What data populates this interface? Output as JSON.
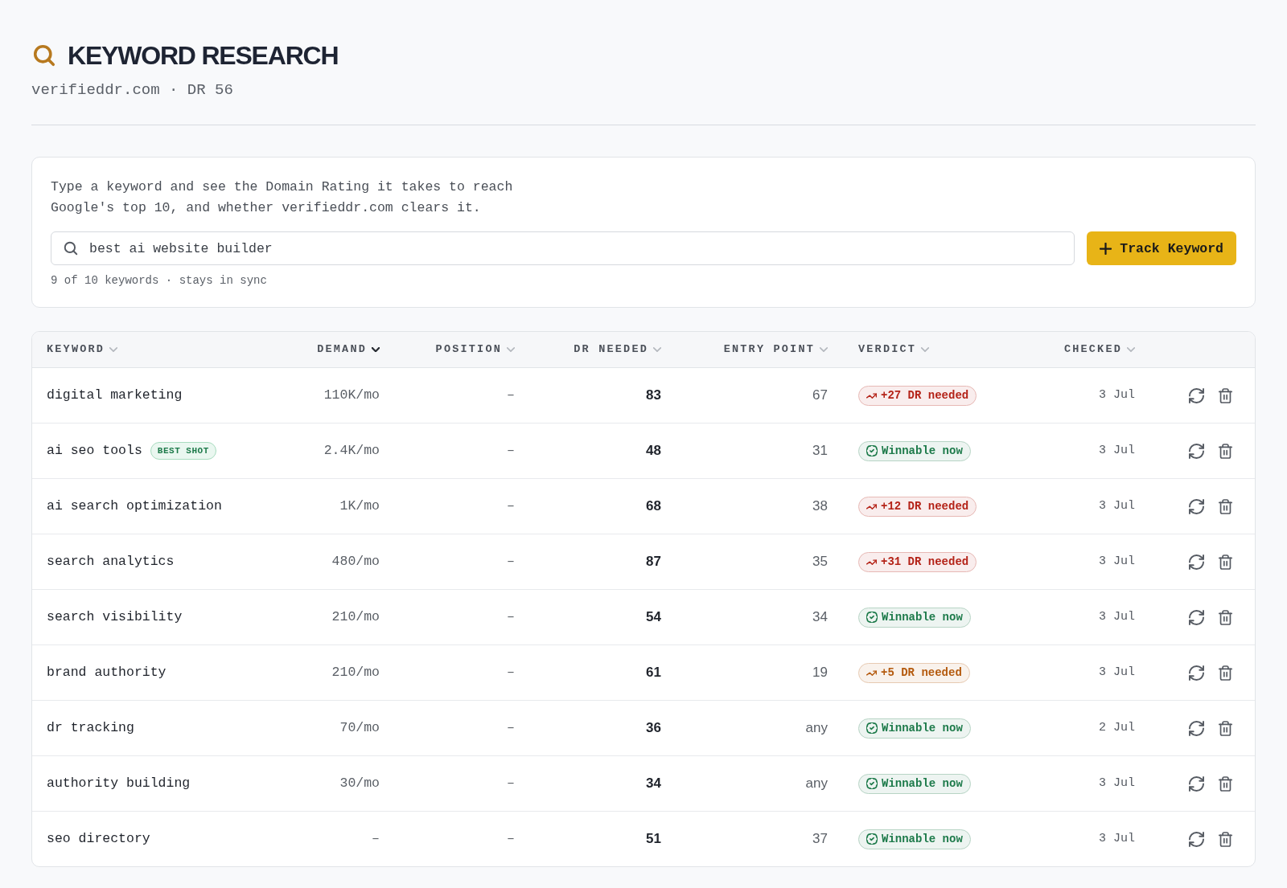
{
  "page": {
    "title": "KEYWORD RESEARCH",
    "subtitle": "verifieddr.com · DR 56"
  },
  "search": {
    "description": "Type a keyword and see the Domain Rating it takes to reach Google's top 10, and whether verifieddr.com clears it.",
    "value": "best ai website builder",
    "button": "Track Keyword",
    "meta": "9 of 10 keywords · stays in sync"
  },
  "table": {
    "columns": [
      {
        "label": "KEYWORD",
        "sorted": false
      },
      {
        "label": "DEMAND",
        "sorted": true
      },
      {
        "label": "POSITION",
        "sorted": false
      },
      {
        "label": "DR NEEDED",
        "sorted": false
      },
      {
        "label": "ENTRY POINT",
        "sorted": false
      },
      {
        "label": "VERDICT",
        "sorted": false
      },
      {
        "label": "CHECKED",
        "sorted": false
      }
    ],
    "rows": [
      {
        "keyword": "digital marketing",
        "demand": "110K/mo",
        "position": "–",
        "dr_needed": "83",
        "entry_point": "67",
        "verdict": {
          "text": "+27 DR needed",
          "kind": "needed",
          "color": "#b42318"
        },
        "checked": "3 Jul"
      },
      {
        "keyword": "ai seo tools",
        "tag": "BEST SHOT",
        "demand": "2.4K/mo",
        "position": "–",
        "dr_needed": "48",
        "entry_point": "31",
        "verdict": {
          "text": "Winnable now",
          "kind": "winnable",
          "color": "#1d7a4a"
        },
        "checked": "3 Jul"
      },
      {
        "keyword": "ai search optimization",
        "demand": "1K/mo",
        "position": "–",
        "dr_needed": "68",
        "entry_point": "38",
        "verdict": {
          "text": "+12 DR needed",
          "kind": "needed",
          "color": "#b42318"
        },
        "checked": "3 Jul"
      },
      {
        "keyword": "search analytics",
        "demand": "480/mo",
        "position": "–",
        "dr_needed": "87",
        "entry_point": "35",
        "verdict": {
          "text": "+31 DR needed",
          "kind": "needed",
          "color": "#b42318"
        },
        "checked": "3 Jul"
      },
      {
        "keyword": "search visibility",
        "demand": "210/mo",
        "position": "–",
        "dr_needed": "54",
        "entry_point": "34",
        "verdict": {
          "text": "Winnable now",
          "kind": "winnable",
          "color": "#1d7a4a"
        },
        "checked": "3 Jul"
      },
      {
        "keyword": "brand authority",
        "demand": "210/mo",
        "position": "–",
        "dr_needed": "61",
        "entry_point": "19",
        "verdict": {
          "text": "+5 DR needed",
          "kind": "needed",
          "color": "#b45a0e"
        },
        "checked": "3 Jul"
      },
      {
        "keyword": "dr tracking",
        "demand": "70/mo",
        "position": "–",
        "dr_needed": "36",
        "entry_point": "any",
        "verdict": {
          "text": "Winnable now",
          "kind": "winnable",
          "color": "#1d7a4a"
        },
        "checked": "2 Jul"
      },
      {
        "keyword": "authority building",
        "demand": "30/mo",
        "position": "–",
        "dr_needed": "34",
        "entry_point": "any",
        "verdict": {
          "text": "Winnable now",
          "kind": "winnable",
          "color": "#1d7a4a"
        },
        "checked": "3 Jul"
      },
      {
        "keyword": "seo directory",
        "demand": "–",
        "position": "–",
        "dr_needed": "51",
        "entry_point": "37",
        "verdict": {
          "text": "Winnable now",
          "kind": "winnable",
          "color": "#1d7a4a"
        },
        "checked": "3 Jul"
      }
    ]
  }
}
